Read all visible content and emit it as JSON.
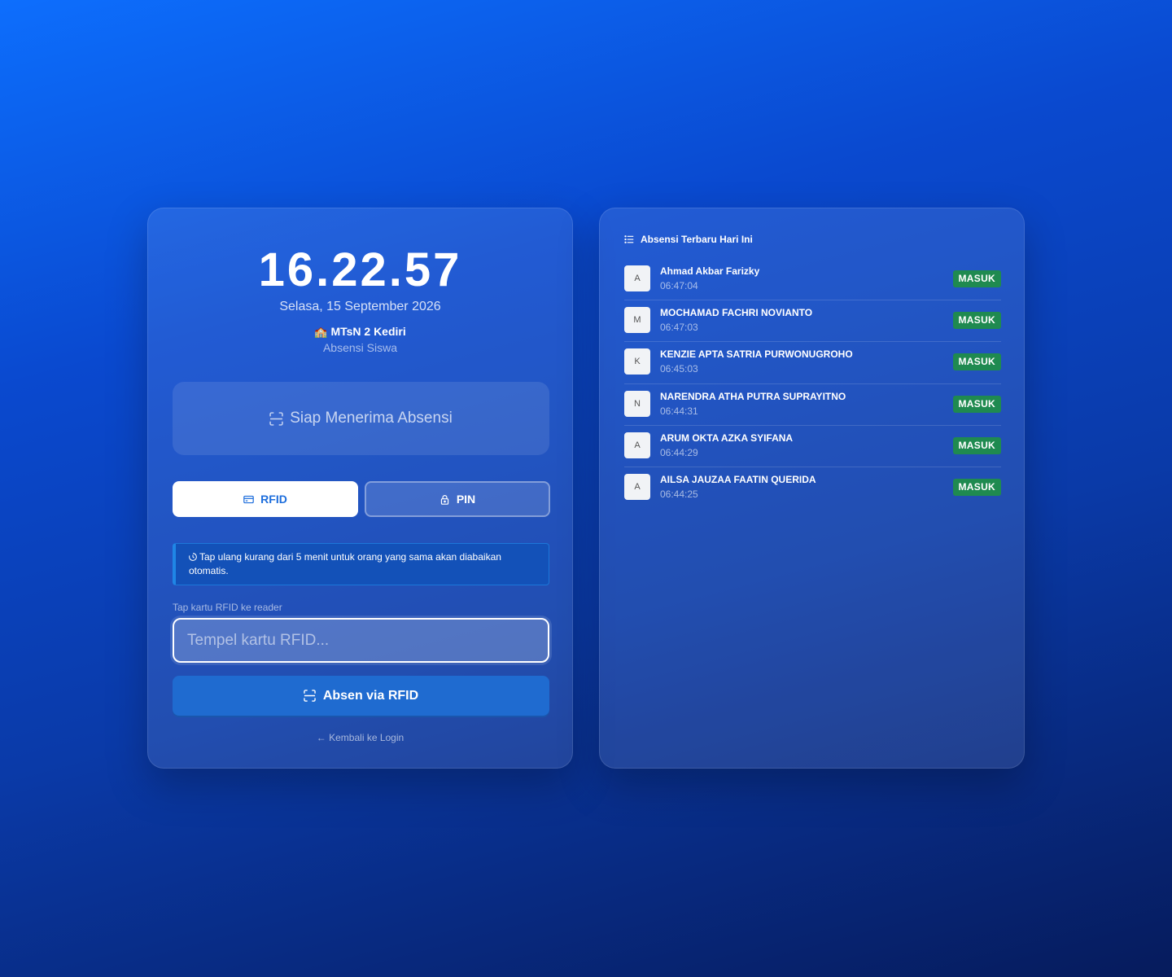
{
  "left": {
    "clock": "16.22.57",
    "date": "Selasa, 15 September 2026",
    "school_emoji": "🏫",
    "school": "MTsN 2 Kediri",
    "subtitle": "Absensi Siswa",
    "status": "Siap Menerima Absensi",
    "modes": {
      "rfid": "RFID",
      "pin": "PIN",
      "active": "rfid"
    },
    "notice": "Tap ulang kurang dari 5 menit untuk orang yang sama akan diabaikan otomatis.",
    "input_label": "Tap kartu RFID ke reader",
    "input_placeholder": "Tempel kartu RFID...",
    "input_value": "",
    "submit_label": "Absen via RFID",
    "back_link": "← Kembali ke Login"
  },
  "recent": {
    "title": "Absensi Terbaru Hari Ini",
    "items": [
      {
        "initial": "A",
        "name": "Ahmad Akbar Farizky",
        "time": "06:47:04",
        "status": "MASUK"
      },
      {
        "initial": "M",
        "name": "MOCHAMAD FACHRI NOVIANTO",
        "time": "06:47:03",
        "status": "MASUK"
      },
      {
        "initial": "K",
        "name": "KENZIE APTA SATRIA PURWONUGROHO",
        "time": "06:45:03",
        "status": "MASUK"
      },
      {
        "initial": "N",
        "name": "NARENDRA ATHA PUTRA SUPRAYITNO",
        "time": "06:44:31",
        "status": "MASUK"
      },
      {
        "initial": "A",
        "name": "ARUM OKTA AZKA SYIFANA",
        "time": "06:44:29",
        "status": "MASUK"
      },
      {
        "initial": "A",
        "name": "AILSA JAUZAA FAATIN QUERIDA",
        "time": "06:44:25",
        "status": "MASUK"
      }
    ]
  },
  "colors": {
    "badge_masuk": "#1f8a50",
    "accent": "#1c6ddc"
  }
}
